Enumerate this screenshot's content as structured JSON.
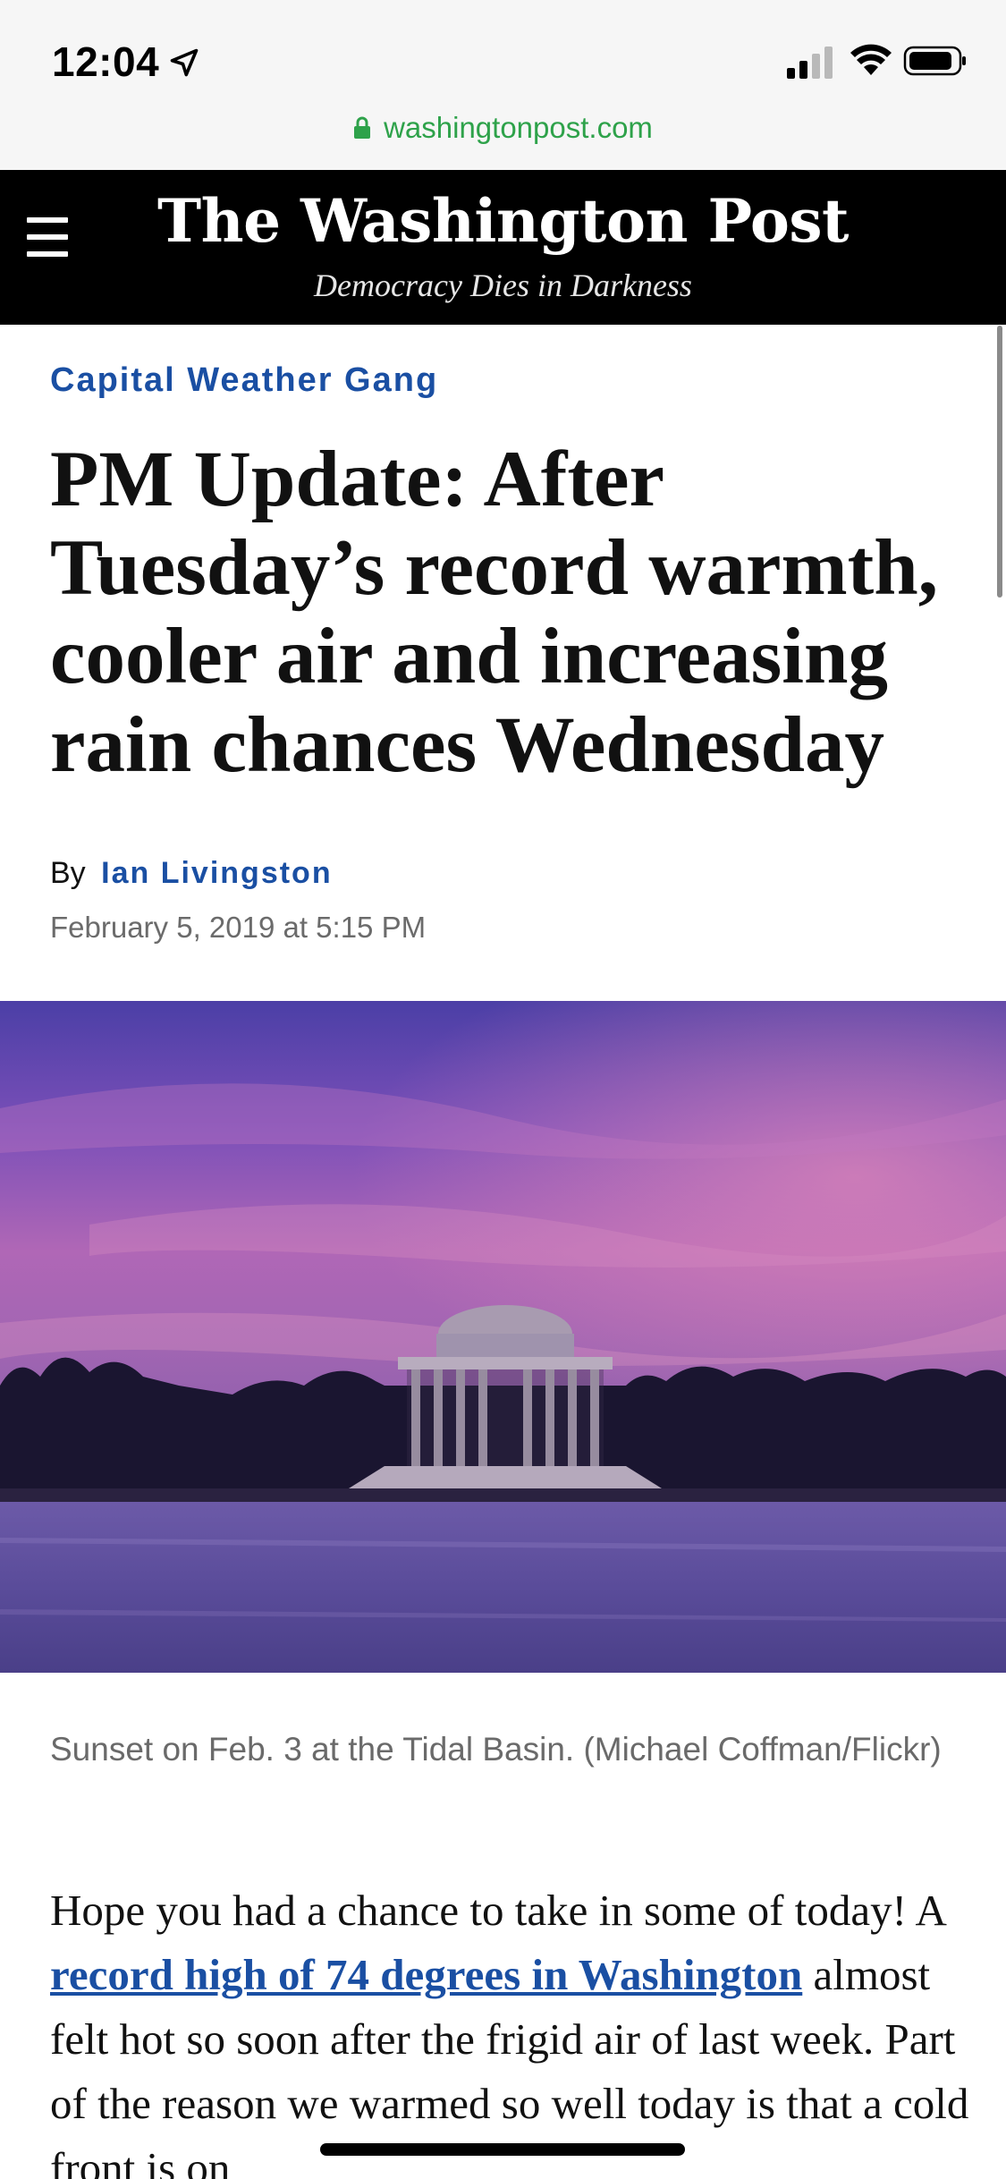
{
  "status_bar": {
    "time": "12:04",
    "icons": [
      "location-arrow-icon",
      "cellular-signal-icon",
      "wifi-icon",
      "battery-icon"
    ]
  },
  "browser": {
    "url": "washingtonpost.com",
    "secure_icon": "lock-icon",
    "url_color": "#2ea24a"
  },
  "header": {
    "menu_icon": "hamburger-menu-icon",
    "masthead": "The Washington Post",
    "tagline": "Democracy Dies in Darkness",
    "background": "#000000"
  },
  "article": {
    "section": "Capital Weather Gang",
    "headline": "PM Update: After Tuesday’s record warmth, cooler air and increasing rain chances Wednesday",
    "byline_prefix": "By",
    "author": "Ian Livingston",
    "date": "February 5, 2019 at 5:15 PM",
    "image_caption": "Sunset on Feb. 3 at the Tidal Basin. (Michael Coffman/Flickr)",
    "body": {
      "part1": "Hope you had a chance to take in some of today! A ",
      "link": "record high of 74 degrees in Washington",
      "part2": " almost felt hot so soon after the frigid air of last week. Part of the reason we warmed so well today is that a cold front is on"
    },
    "accent_color": "#1a4fa3"
  }
}
